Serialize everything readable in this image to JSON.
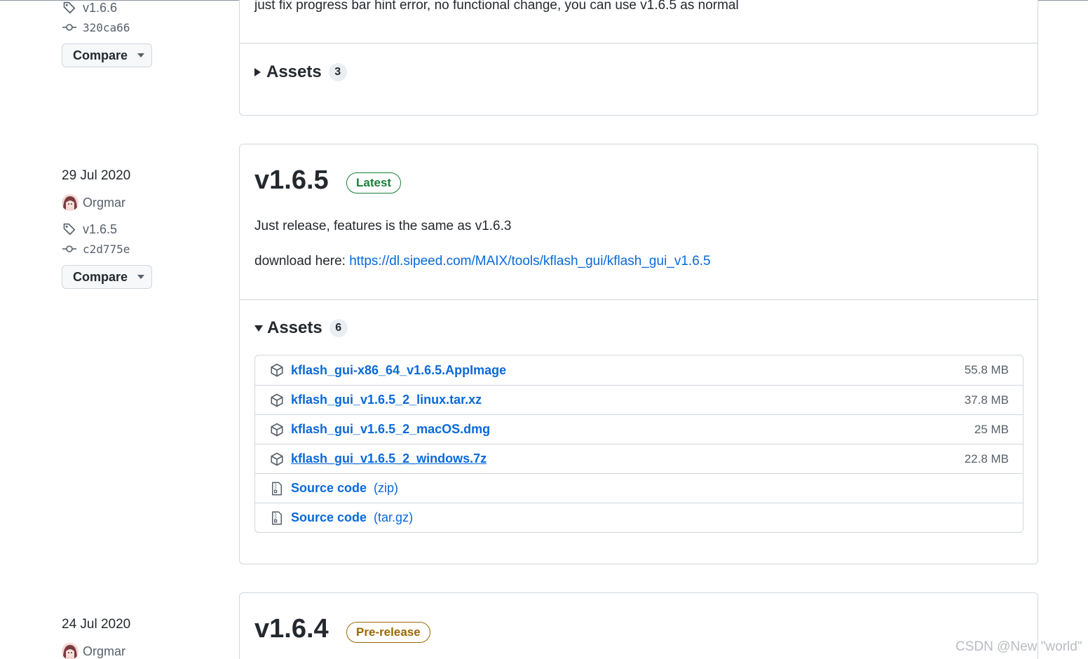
{
  "prev_release": {
    "tag": "v1.6.6",
    "commit": "320ca66",
    "compare_label": "Compare",
    "description": "just fix progress bar hint error, no functional change, you can use v1.6.5 as normal",
    "assets_label": "Assets",
    "assets_count": "3"
  },
  "release": {
    "date": "29 Jul 2020",
    "author": "Orgmar",
    "tag": "v1.6.5",
    "commit": "c2d775e",
    "compare_label": "Compare",
    "title": "v1.6.5",
    "badge": "Latest",
    "description": "Just release, features is the same as v1.6.3",
    "download_prefix": "download here: ",
    "download_link": "https://dl.sipeed.com/MAIX/tools/kflash_gui/kflash_gui_v1.6.5",
    "assets_label": "Assets",
    "assets_count": "6",
    "assets": [
      {
        "name": "kflash_gui-x86_64_v1.6.5.AppImage",
        "size": "55.8 MB",
        "icon": "package-icon"
      },
      {
        "name": "kflash_gui_v1.6.5_2_linux.tar.xz",
        "size": "37.8 MB",
        "icon": "package-icon"
      },
      {
        "name": "kflash_gui_v1.6.5_2_macOS.dmg",
        "size": "25 MB",
        "icon": "package-icon"
      },
      {
        "name": "kflash_gui_v1.6.5_2_windows.7z",
        "size": "22.8 MB",
        "icon": "package-icon"
      },
      {
        "name": "Source code",
        "format": "(zip)",
        "icon": "file-zip-icon"
      },
      {
        "name": "Source code",
        "format": "(tar.gz)",
        "icon": "file-zip-icon"
      }
    ]
  },
  "next_release": {
    "date": "24 Jul 2020",
    "author": "Orgmar",
    "title": "v1.6.4",
    "badge": "Pre-release"
  },
  "watermark": "CSDN @New \"world\"",
  "colors": {
    "link": "#0969da",
    "latest": "#1a7f37",
    "prerelease": "#9a6700",
    "border": "#d0d7de"
  }
}
